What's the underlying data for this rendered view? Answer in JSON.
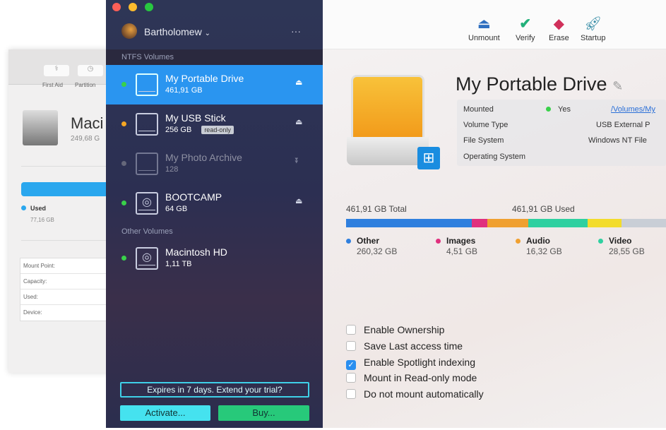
{
  "back_window": {
    "toolbar": [
      {
        "label": "First Aid",
        "icon": "stethoscope-icon"
      },
      {
        "label": "Partition",
        "icon": "partition-icon"
      }
    ],
    "disk_name": "Maci",
    "disk_size": "249,68 G",
    "used_label": "Used",
    "used_value": "77,16 GB",
    "info_rows": [
      "Mount Point:",
      "Capacity:",
      "Used:",
      "Device:"
    ],
    "bar_color": "#2aa7ee"
  },
  "sidebar": {
    "user": "Bartholomew",
    "more": "···",
    "sections": [
      {
        "title": "NTFS Volumes"
      },
      {
        "title": "Other Volumes"
      }
    ],
    "items": [
      {
        "name": "My Portable Drive",
        "size": "461,91 GB",
        "status": "#39d14a",
        "selected": true,
        "icon": "drive-icon",
        "action": "eject-icon"
      },
      {
        "name": "My USB Stick",
        "size": "256 GB",
        "badge": "read-only",
        "status": "#f5a623",
        "icon": "drive-icon",
        "action": "eject-icon"
      },
      {
        "name": "My Photo Archive",
        "size": "128",
        "status": "#888888",
        "disabled": true,
        "icon": "drive-icon",
        "action": "mount-icon"
      },
      {
        "name": "BOOTCAMP",
        "size": "64 GB",
        "status": "#39d14a",
        "icon": "hard-disk-icon",
        "action": "eject-icon"
      },
      {
        "name": "Macintosh HD",
        "size": "1,11 TB",
        "status": "#39d14a",
        "icon": "hard-disk-icon"
      }
    ],
    "trial": "Expires in 7 days. Extend your trial?",
    "activate": "Activate...",
    "buy": "Buy..."
  },
  "toolbar": {
    "unmount": "Unmount",
    "verify": "Verify",
    "erase": "Erase",
    "startup": "Startup"
  },
  "drive": {
    "title": "My Portable Drive",
    "props": {
      "mounted_label": "Mounted",
      "mounted_value": "Yes",
      "mount_path": "/Volumes/My",
      "volume_type_label": "Volume Type",
      "volume_type": "USB External P",
      "fs_label": "File System",
      "fs": "Windows NT File",
      "os_label": "Operating System"
    },
    "total": "461,91 GB Total",
    "used": "461,91 GB Used",
    "legend": [
      {
        "name": "Other",
        "value": "260,32 GB",
        "color": "#2f7fde"
      },
      {
        "name": "Images",
        "value": "4,51 GB",
        "color": "#e0307e"
      },
      {
        "name": "Audio",
        "value": "16,32 GB",
        "color": "#f0a030"
      },
      {
        "name": "Video",
        "value": "28,55 GB",
        "color": "#2fd0a0"
      }
    ],
    "extra_colors": [
      "#f3dc2b",
      "#c9ced6"
    ]
  },
  "options": [
    {
      "label": "Enable Ownership",
      "checked": false
    },
    {
      "label": "Save Last access time",
      "checked": false
    },
    {
      "label": "Enable Spotlight indexing",
      "checked": true
    },
    {
      "label": "Mount in Read-only mode",
      "checked": false
    },
    {
      "label": "Do not mount automatically",
      "checked": false
    }
  ]
}
